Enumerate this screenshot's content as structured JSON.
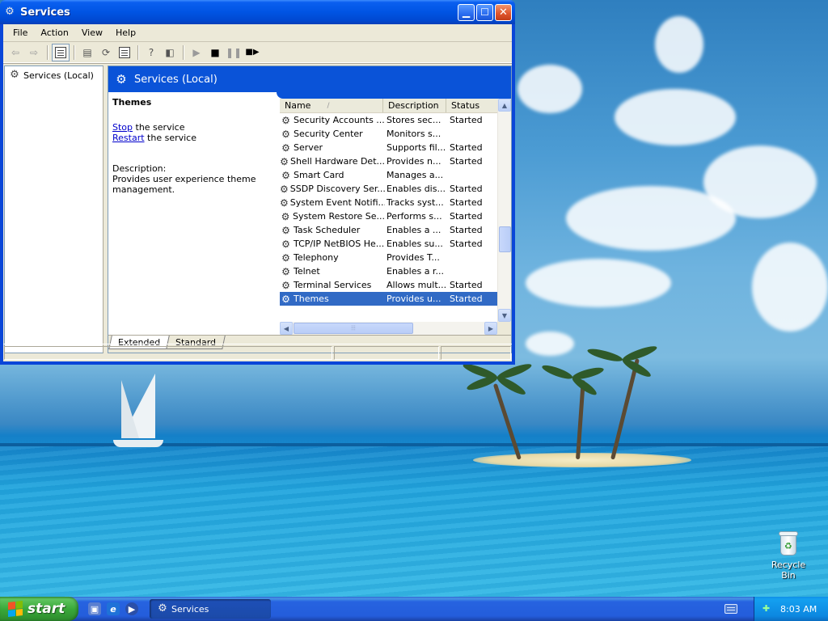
{
  "window": {
    "title": "Services",
    "menu": [
      "File",
      "Action",
      "View",
      "Help"
    ]
  },
  "tree": {
    "root": "Services (Local)"
  },
  "header": {
    "title": "Services (Local)"
  },
  "details": {
    "service_name": "Themes",
    "stop_link": "Stop",
    "stop_rest": " the service",
    "restart_link": "Restart",
    "restart_rest": " the service",
    "description_label": "Description:",
    "description_text": "Provides user experience theme management."
  },
  "list": {
    "columns": {
      "name": "Name",
      "description": "Description",
      "status": "Status"
    },
    "rows": [
      {
        "name": "Security Accounts ...",
        "description": "Stores sec...",
        "status": "Started"
      },
      {
        "name": "Security Center",
        "description": "Monitors s...",
        "status": ""
      },
      {
        "name": "Server",
        "description": "Supports fil...",
        "status": "Started"
      },
      {
        "name": "Shell Hardware Det...",
        "description": "Provides n...",
        "status": "Started"
      },
      {
        "name": "Smart Card",
        "description": "Manages a...",
        "status": ""
      },
      {
        "name": "SSDP Discovery Ser...",
        "description": "Enables dis...",
        "status": "Started"
      },
      {
        "name": "System Event Notifi...",
        "description": "Tracks syst...",
        "status": "Started"
      },
      {
        "name": "System Restore Se...",
        "description": "Performs s...",
        "status": "Started"
      },
      {
        "name": "Task Scheduler",
        "description": "Enables a ...",
        "status": "Started"
      },
      {
        "name": "TCP/IP NetBIOS He...",
        "description": "Enables su...",
        "status": "Started"
      },
      {
        "name": "Telephony",
        "description": "Provides T...",
        "status": ""
      },
      {
        "name": "Telnet",
        "description": "Enables a r...",
        "status": ""
      },
      {
        "name": "Terminal Services",
        "description": "Allows mult...",
        "status": "Started"
      },
      {
        "name": "Themes",
        "description": "Provides u...",
        "status": "Started",
        "selected": true
      }
    ]
  },
  "tabs": [
    "Extended",
    "Standard"
  ],
  "desktop": {
    "recycle_bin": "Recycle Bin"
  },
  "taskbar": {
    "start_label": "start",
    "task_label": "Services",
    "clock": "8:03 AM"
  },
  "colors": {
    "selection": "#316ac5",
    "title_blue": "#0054e3",
    "start_green": "#3aa93a",
    "link": "#0000cc"
  }
}
